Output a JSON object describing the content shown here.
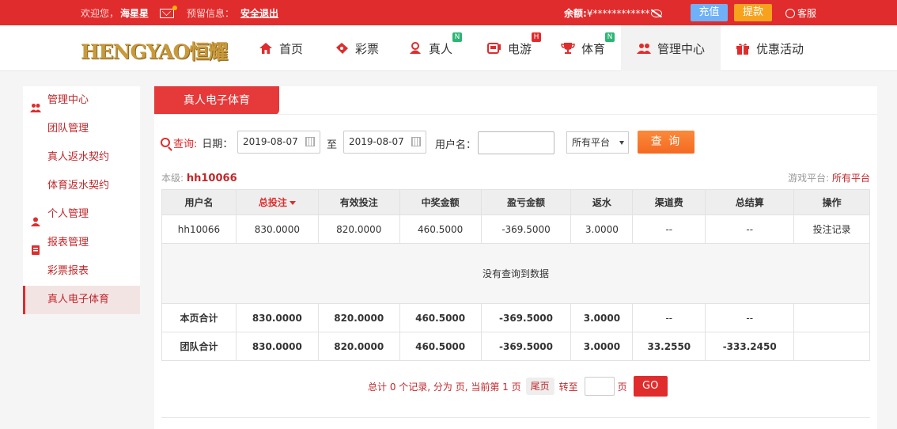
{
  "topbar": {
    "welcome": "欢迎您，",
    "username": "海星星",
    "notice_label": "预留信息：",
    "logout": "安全退出",
    "balance_label": "余额:",
    "balance_value": "¥************",
    "deposit": "充值",
    "withdraw": "提款",
    "service": "客服"
  },
  "nav": {
    "logo_text": "HENGYAO恒耀",
    "items": [
      {
        "label": "首页",
        "icon": "home-icon",
        "badge": ""
      },
      {
        "label": "彩票",
        "icon": "ticket-icon",
        "badge": ""
      },
      {
        "label": "真人",
        "icon": "dealer-icon",
        "badge": "N"
      },
      {
        "label": "电游",
        "icon": "slot-icon",
        "badge": "H"
      },
      {
        "label": "体育",
        "icon": "trophy-icon",
        "badge": "N"
      },
      {
        "label": "管理中心",
        "icon": "users-icon",
        "badge": ""
      },
      {
        "label": "优惠活动",
        "icon": "gift-icon",
        "badge": ""
      }
    ],
    "active_index": 5
  },
  "sidebar": {
    "items": [
      {
        "label": "管理中心",
        "type": "group",
        "icon": "users-icon"
      },
      {
        "label": "团队管理",
        "type": "sub"
      },
      {
        "label": "真人返水契约",
        "type": "sub"
      },
      {
        "label": "体育返水契约",
        "type": "sub"
      },
      {
        "label": "个人管理",
        "type": "group",
        "icon": "user-icon"
      },
      {
        "label": "报表管理",
        "type": "group",
        "icon": "report-icon"
      },
      {
        "label": "彩票报表",
        "type": "sub"
      },
      {
        "label": "真人电子体育",
        "type": "sub",
        "active": true
      }
    ]
  },
  "panel": {
    "tab": "真人电子体育",
    "query": {
      "label": "查询:",
      "date_label": "日期：",
      "date_from": "2019-08-07",
      "to_label": "至",
      "date_to": "2019-08-07",
      "user_label": "用户名：",
      "user_value": "",
      "platform": "所有平台",
      "search_btn": "查 询"
    },
    "level_label": "本级:",
    "level_user": "hh10066",
    "platform_label": "游戏平台:",
    "platform_value": "所有平台",
    "table": {
      "headers": [
        "用户名",
        "总投注",
        "有效投注",
        "中奖金额",
        "盈亏金额",
        "返水",
        "渠道费",
        "总结算",
        "操作"
      ],
      "row": [
        "hh10066",
        "830.0000",
        "820.0000",
        "460.5000",
        "-369.5000",
        "3.0000",
        "--",
        "--",
        "投注记录"
      ],
      "empty": "没有查询到数据",
      "page_total": [
        "本页合计",
        "830.0000",
        "820.0000",
        "460.5000",
        "-369.5000",
        "3.0000",
        "--",
        "--",
        ""
      ],
      "team_total": [
        "团队合计",
        "830.0000",
        "820.0000",
        "460.5000",
        "-369.5000",
        "3.0000",
        "33.2550",
        "-333.2450",
        ""
      ]
    },
    "pager": {
      "summary": "总计 0 个记录, 分为 页, 当前第 1 页",
      "last": "尾页",
      "goto": "转至",
      "page_unit": "页",
      "go": "GO"
    }
  }
}
